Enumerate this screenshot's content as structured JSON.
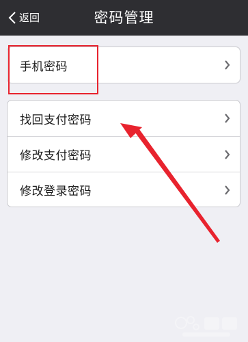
{
  "header": {
    "back_label": "返回",
    "title": "密码管理"
  },
  "group1": {
    "items": [
      {
        "label": "手机密码"
      }
    ]
  },
  "group2": {
    "items": [
      {
        "label": "找回支付密码"
      },
      {
        "label": "修改支付密码"
      },
      {
        "label": "修改登录密码"
      }
    ]
  },
  "icons": {
    "back": "chevron-left-icon",
    "row_chevron": "chevron-right-icon"
  },
  "colors": {
    "navbar_bg": "#2e2e32",
    "page_bg": "#efeff4",
    "annotation_red": "#e8232e"
  }
}
